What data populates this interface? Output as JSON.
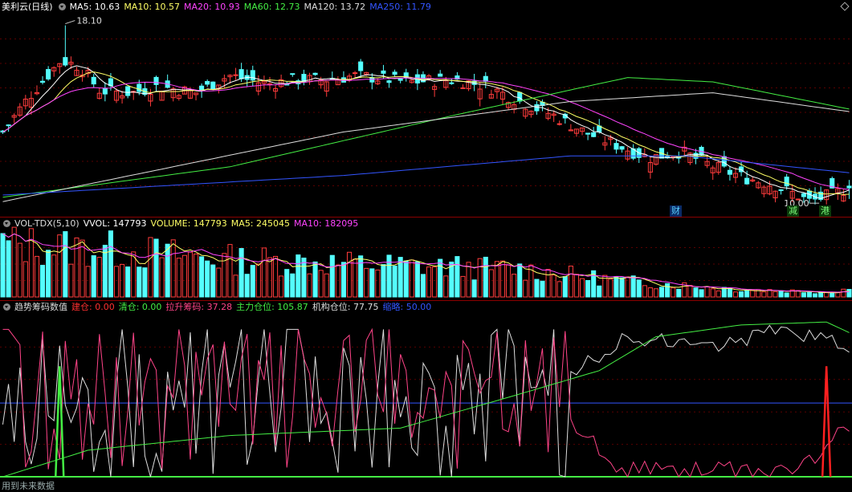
{
  "kline": {
    "title": "美利云(日线)",
    "ma": [
      {
        "label": "MA5: 10.63",
        "color": "#ffffff"
      },
      {
        "label": "MA10: 10.57",
        "color": "#ffff66"
      },
      {
        "label": "MA20: 10.93",
        "color": "#ff44ff"
      },
      {
        "label": "MA60: 12.73",
        "color": "#44ee44"
      },
      {
        "label": "MA120: 13.72",
        "color": "#dddddd"
      },
      {
        "label": "MA250: 11.79",
        "color": "#3355ff"
      }
    ],
    "high_label": "18.10",
    "low_label": "10.00",
    "events": [
      "财",
      "减",
      "港"
    ]
  },
  "volume": {
    "title": "VOL-TDX(5,10)",
    "items": [
      {
        "label": "VVOL: 147793",
        "color": "#ffffff"
      },
      {
        "label": "VOLUME: 147793",
        "color": "#ffff66"
      },
      {
        "label": "MA5: 245045",
        "color": "#ffff66"
      },
      {
        "label": "MA10: 182095",
        "color": "#ff44ff"
      }
    ]
  },
  "indicator": {
    "title": "趋势筹码数值",
    "items": [
      {
        "label": "建仓: 0.00",
        "color": "#ff3030"
      },
      {
        "label": "清仓: 0.00",
        "color": "#44ee44"
      },
      {
        "label": "拉升筹码: 37.28",
        "color": "#ff4488"
      },
      {
        "label": "主力仓位: 105.87",
        "color": "#44ee44"
      },
      {
        "label": "机构仓位: 77.75",
        "color": "#dddddd"
      },
      {
        "label": "缩略: 50.00",
        "color": "#3355ff"
      }
    ]
  },
  "footer": "用到未来数据",
  "chart_data": [
    {
      "type": "candlestick",
      "x_count": 150,
      "ylim": [
        9.6,
        18.6
      ],
      "marked": {
        "high": 18.1,
        "low": 10.0
      },
      "anchors_close": [
        [
          0,
          13.2
        ],
        [
          8,
          14.8
        ],
        [
          18,
          16.5
        ],
        [
          24,
          16.2
        ],
        [
          30,
          15.1
        ],
        [
          40,
          15.0
        ],
        [
          48,
          15.3
        ],
        [
          60,
          15.0
        ],
        [
          70,
          15.8
        ],
        [
          82,
          15.4
        ],
        [
          90,
          15.6
        ],
        [
          100,
          15.6
        ],
        [
          110,
          15.8
        ],
        [
          125,
          15.5
        ],
        [
          140,
          15.6
        ],
        [
          150,
          15.3
        ],
        [
          160,
          14.6
        ],
        [
          170,
          14.0
        ],
        [
          180,
          13.2
        ],
        [
          190,
          12.6
        ],
        [
          200,
          12.0
        ],
        [
          210,
          12.3
        ],
        [
          220,
          11.6
        ],
        [
          230,
          11.1
        ],
        [
          240,
          10.7
        ],
        [
          250,
          10.0
        ],
        [
          258,
          10.4
        ],
        [
          262,
          10.63
        ]
      ]
    },
    {
      "type": "bar",
      "series": [
        {
          "name": "VOLUME",
          "level": "relative"
        }
      ],
      "ma": [
        "MA5",
        "MA10"
      ]
    },
    {
      "type": "line",
      "ylim": [
        0,
        110
      ],
      "series_names": [
        "建仓",
        "清仓",
        "拉升筹码",
        "主力仓位",
        "机构仓位",
        "缩略"
      ],
      "baseline": 50
    }
  ]
}
